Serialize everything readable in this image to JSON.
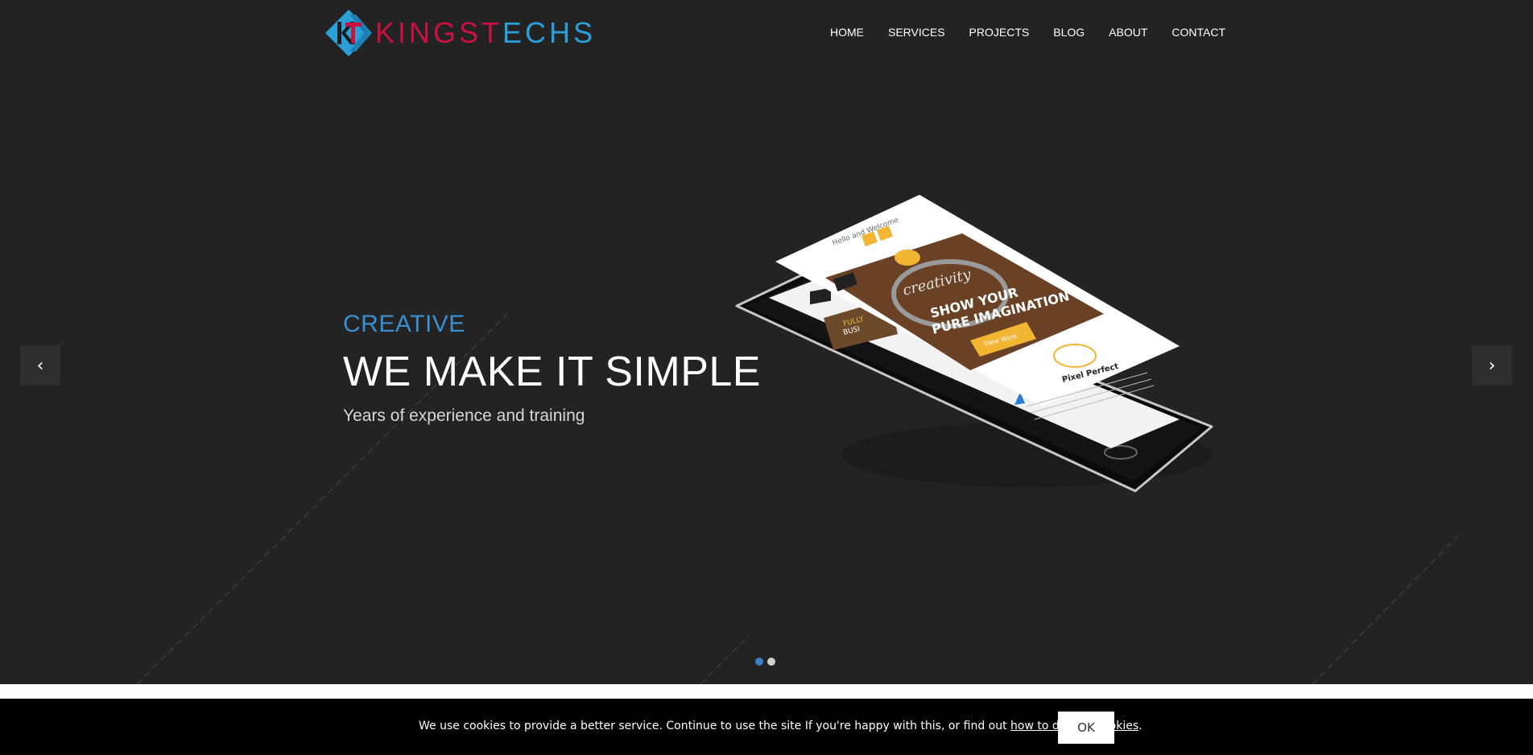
{
  "brand": {
    "logo_mark_text": "KT",
    "logo_text_first": "KINGS",
    "logo_text_highlight": "T",
    "logo_text_last": "ECHS",
    "colors": {
      "red": "#c9123f",
      "blue": "#2a9fd8"
    }
  },
  "nav": {
    "items": [
      "HOME",
      "SERVICES",
      "PROJECTS",
      "BLOG",
      "ABOUT",
      "CONTACT"
    ]
  },
  "hero": {
    "kicker": "CREATIVE",
    "headline": "WE MAKE IT SIMPLE",
    "subline": "Years of experience and training",
    "background": "#232323",
    "accent": "#3a8fd0",
    "prev_icon": "chevron-left-icon",
    "next_icon": "chevron-right-icon",
    "slides_total": 2,
    "active_slide": 1
  },
  "mockup": {
    "greeting": "Hello and Welcome",
    "banner_line1": "SHOW YOUR",
    "banner_line2": "PURE IMAGINATION",
    "script_word": "creativity",
    "button_label": "View Work",
    "feature_title": "Pixel Perfect",
    "side_label_1": "FULLY",
    "side_label_2": "BUSI"
  },
  "cookie": {
    "text": "We use cookies to provide a better service. Continue to use the site If you're happy with this, or find out",
    "link_text": "how to disable cookies",
    "suffix": ".",
    "ok_label": "OK"
  }
}
